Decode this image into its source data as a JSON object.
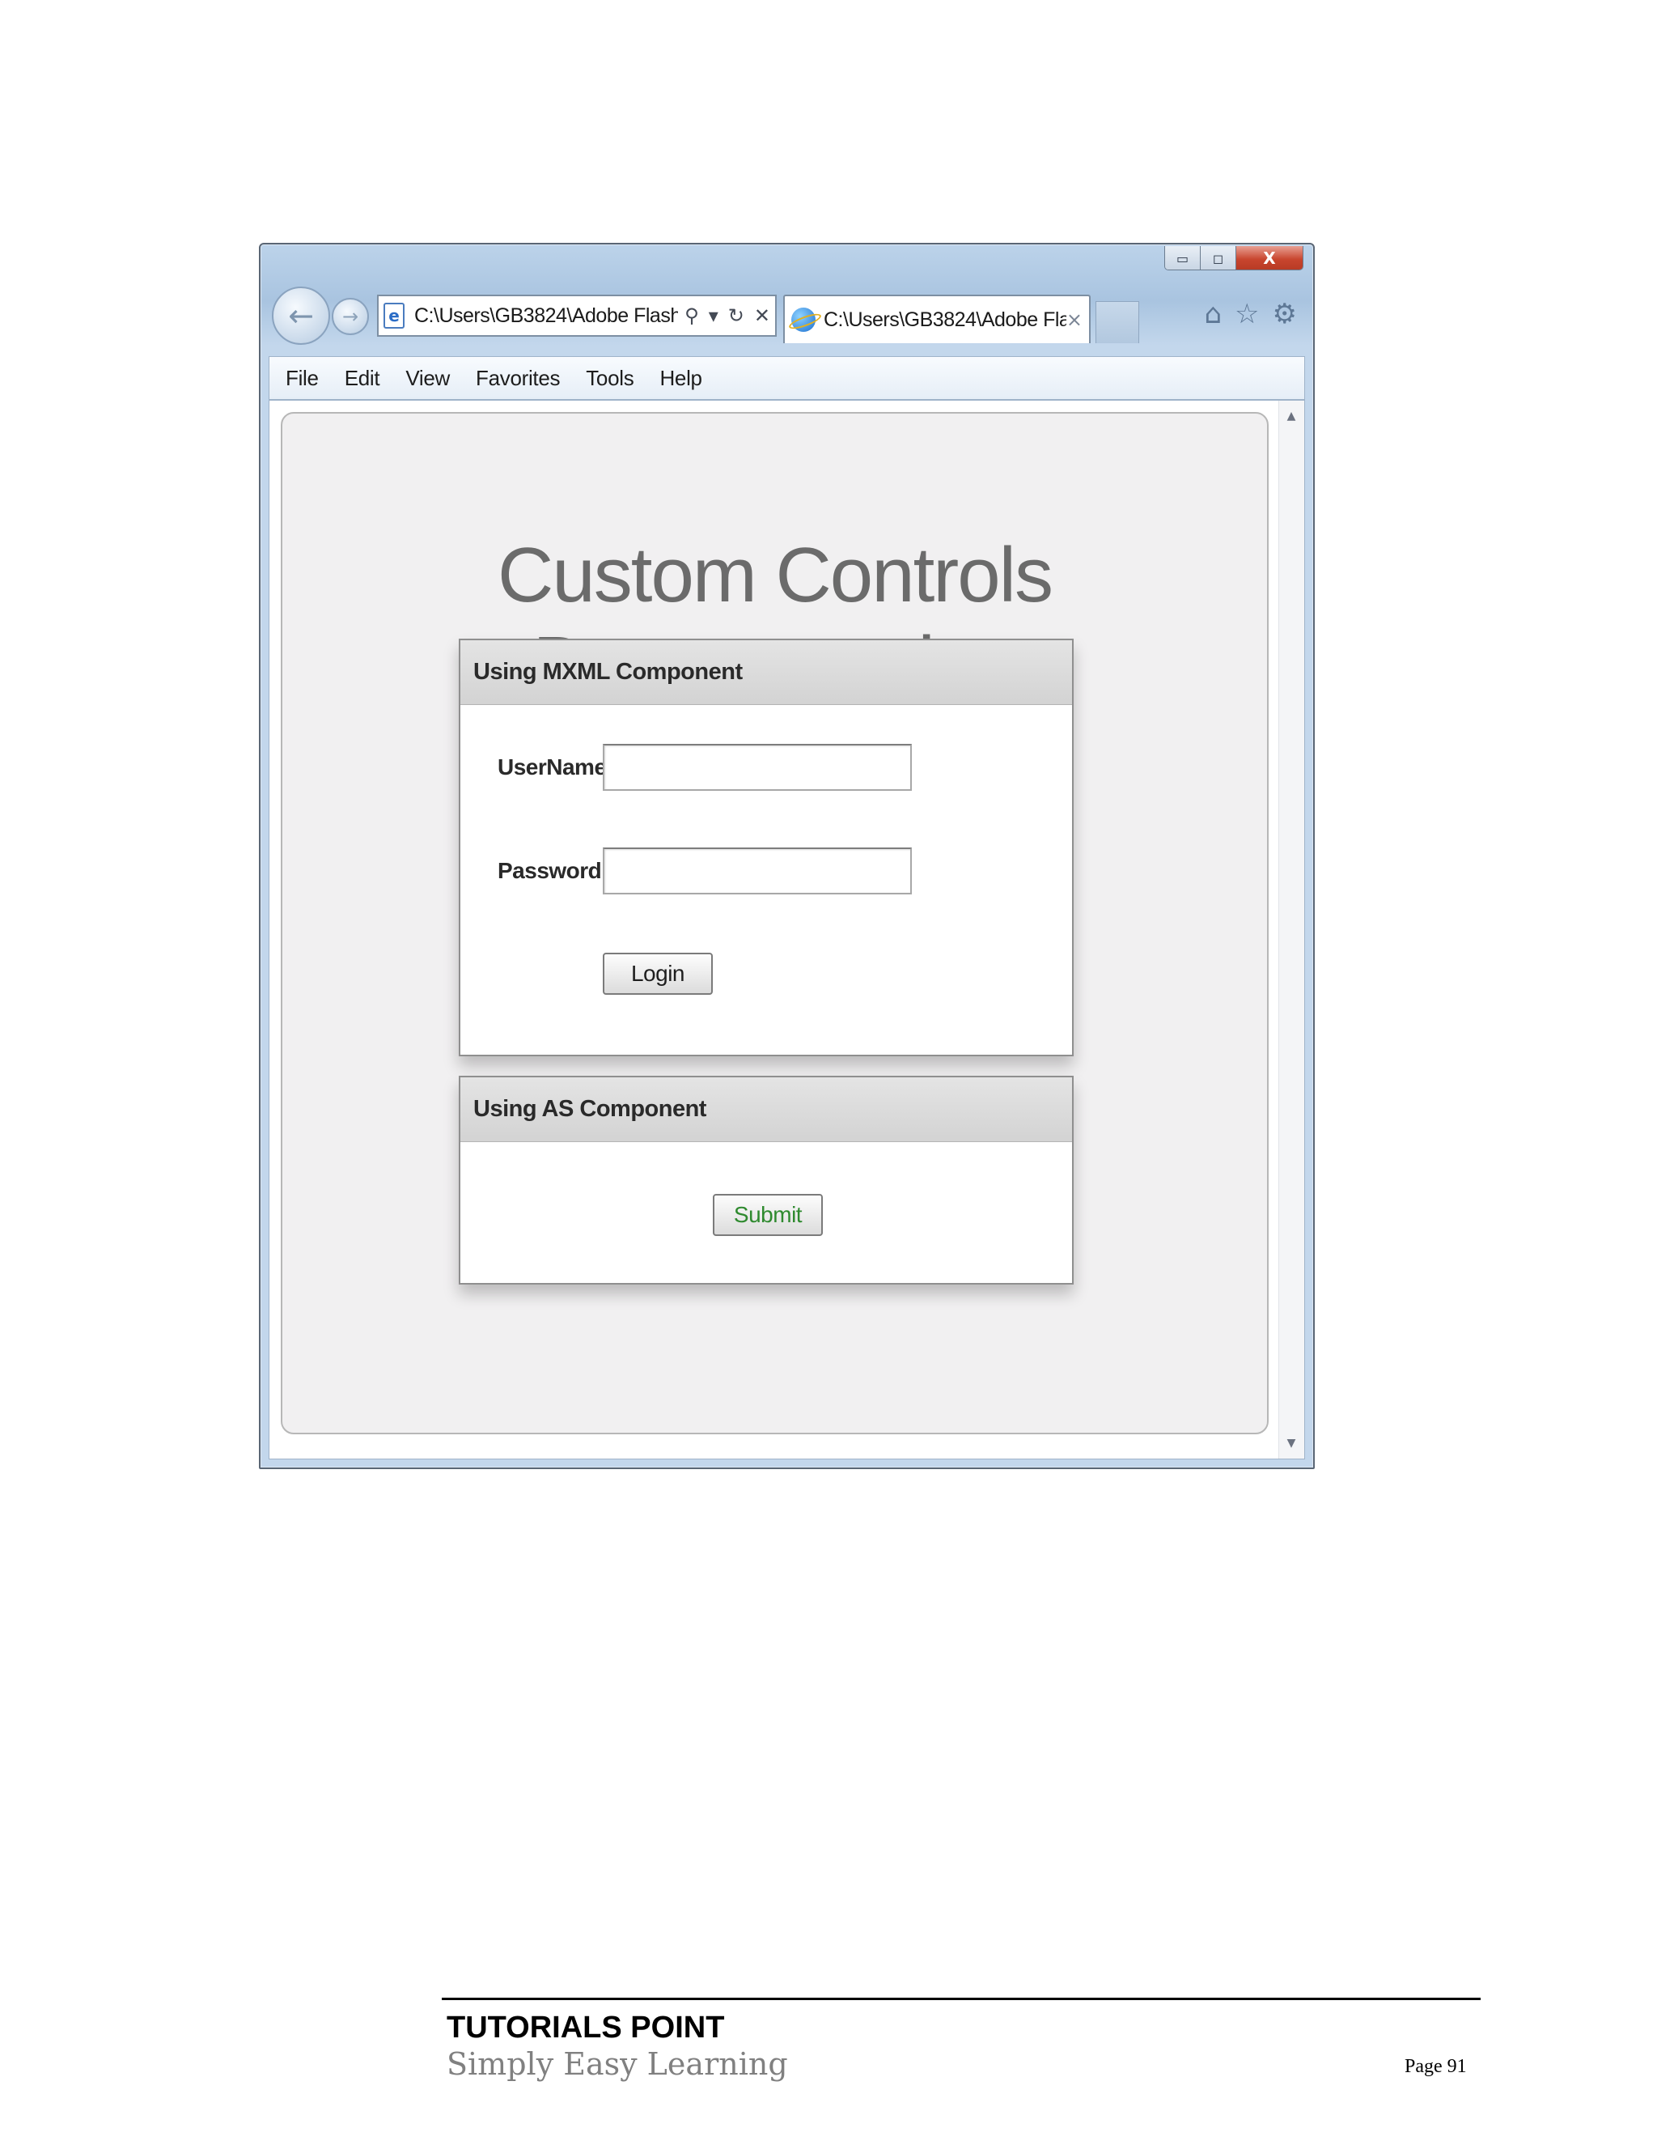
{
  "browser": {
    "window_controls": {
      "minimize": "▭",
      "maximize": "◻",
      "close": "X"
    },
    "nav": {
      "back_glyph": "←",
      "forward_glyph": "→"
    },
    "address": {
      "value": "C:\\Users\\GB3824\\Adobe Flash",
      "search_glyph": "⚲",
      "dropdown_glyph": "▾",
      "refresh_glyph": "↻",
      "stop_glyph": "✕",
      "page_icon_glyph": "e"
    },
    "tab": {
      "label": "C:\\Users\\GB3824\\Adobe Fla...",
      "close_glyph": "×"
    },
    "toolbar": {
      "home_glyph": "⌂",
      "favorites_glyph": "☆",
      "tools_glyph": "⚙"
    },
    "menu": [
      "File",
      "Edit",
      "View",
      "Favorites",
      "Tools",
      "Help"
    ],
    "scroll": {
      "up": "▲",
      "down": "▼"
    }
  },
  "app": {
    "title": "Custom Controls Demonstration",
    "mxml_panel": {
      "header": "Using MXML Component",
      "username_label": "UserName:",
      "username_value": "",
      "password_label": "Password:",
      "password_value": "",
      "login_label": "Login"
    },
    "as_panel": {
      "header": "Using AS Component",
      "submit_label": "Submit"
    }
  },
  "footer": {
    "brand": "TUTORIALS POINT",
    "tagline": "Simply Easy Learning",
    "page": "Page 91"
  },
  "colors": {
    "window_frame": "#a9c4e0",
    "close_button": "#c8452e",
    "app_background": "#f1f0f1",
    "title_text": "#6b6b6b",
    "submit_text": "#2f8a2f"
  }
}
